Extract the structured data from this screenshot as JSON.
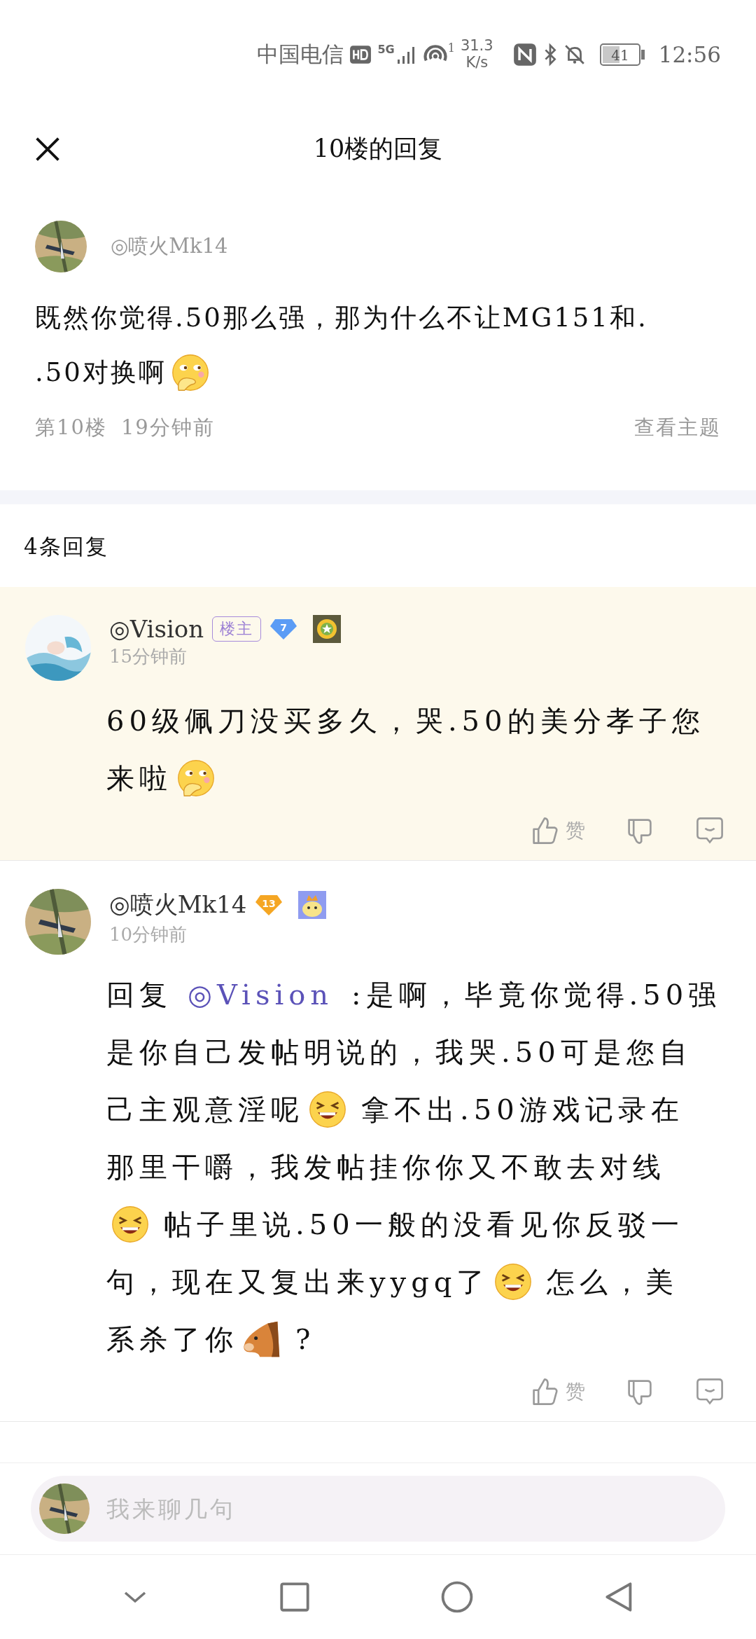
{
  "status_bar": {
    "carrier": "中国电信",
    "network": "5G",
    "wifi_sup": "1",
    "speed_value": "31.3",
    "speed_unit": "K/s",
    "battery": "41",
    "time": "12:56"
  },
  "header": {
    "title": "10楼的回复"
  },
  "post": {
    "author": "◎喷火Mk14",
    "body": [
      [
        {
          "kind": "text",
          "text": "既然你觉得.50那么强，那为什么不让MG151和."
        }
      ],
      [
        {
          "kind": "text",
          "text": ".50对换啊"
        },
        {
          "kind": "emoji-cover"
        }
      ]
    ],
    "floor": "第10楼",
    "time": "19分钟前",
    "link": "查看主题"
  },
  "reply_count": "4条回复",
  "replies": [
    {
      "author": "◎Vision",
      "op_badge": "楼主",
      "level": {
        "text": "7",
        "color": "#5b9cf5"
      },
      "highlighted": true,
      "time": "15分钟前",
      "like_label": "赞",
      "body": [
        [
          {
            "kind": "text",
            "text": "60级佩刀没买多久，哭.50的美分孝子您"
          }
        ],
        [
          {
            "kind": "text",
            "text": "来啦"
          },
          {
            "kind": "emoji-cover"
          }
        ]
      ]
    },
    {
      "author": "◎喷火Mk14",
      "level": {
        "text": "13",
        "color": "#f5a623"
      },
      "highlighted": false,
      "time": "10分钟前",
      "like_label": "赞",
      "body": [
        [
          {
            "kind": "text",
            "text": "回复"
          },
          {
            "kind": "mention",
            "text": "◎Vision"
          },
          {
            "kind": "text",
            "text": ":是啊，毕竟你觉得.50强"
          }
        ],
        [
          {
            "kind": "text",
            "text": "是你自己发帖明说的，我哭.50可是您自"
          }
        ],
        [
          {
            "kind": "text",
            "text": "己主观意淫呢"
          },
          {
            "kind": "emoji-grin"
          },
          {
            "kind": "text",
            "text": "拿不出.50游戏记录在"
          }
        ],
        [
          {
            "kind": "text",
            "text": "那里干嚼，我发帖挂你你又不敢去对线"
          }
        ],
        [
          {
            "kind": "emoji-grin"
          },
          {
            "kind": "text",
            "text": "帖子里说.50一般的没看见你反驳一"
          }
        ],
        [
          {
            "kind": "text",
            "text": "句，现在又复出来yygq了"
          },
          {
            "kind": "emoji-grin"
          },
          {
            "kind": "text",
            "text": "怎么，美"
          }
        ],
        [
          {
            "kind": "text",
            "text": "系杀了你"
          },
          {
            "kind": "emoji-horse"
          },
          {
            "kind": "text",
            "text": "?"
          }
        ]
      ]
    }
  ],
  "composer": {
    "placeholder": "我来聊几句"
  }
}
